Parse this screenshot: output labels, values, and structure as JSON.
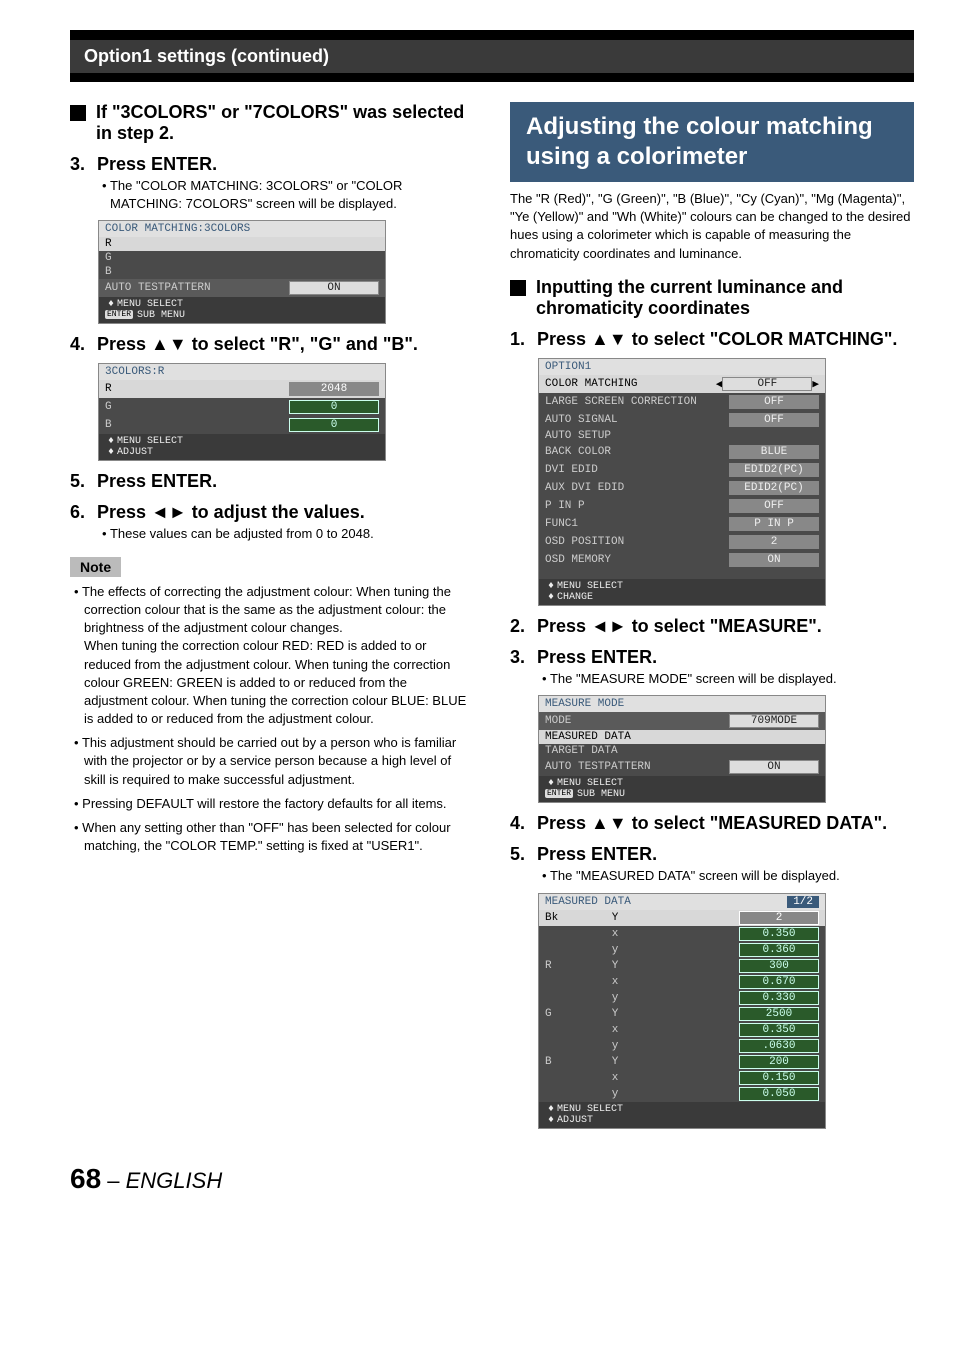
{
  "header": "Option1 settings (continued)",
  "left": {
    "sq_heading": "If \"3COLORS\" or \"7COLORS\" was selected in step 2.",
    "step3": "Press ENTER.",
    "step3_sub": "The \"COLOR MATCHING: 3COLORS\" or \"COLOR MATCHING: 7COLORS\" screen will be displayed.",
    "menu1": {
      "title": "COLOR MATCHING:3COLORS",
      "rows": [
        "R",
        "G",
        "B"
      ],
      "auto": "AUTO TESTPATTERN",
      "auto_val": "ON",
      "foot1": "MENU SELECT",
      "foot2": "SUB MENU",
      "enter": "ENTER"
    },
    "step4": "Press ▲▼ to select \"R\", \"G\" and \"B\".",
    "menu2": {
      "title": "3COLORS:R",
      "rows": [
        {
          "label": "R",
          "val": "2048"
        },
        {
          "label": "G",
          "val": "0"
        },
        {
          "label": "B",
          "val": "0"
        }
      ],
      "foot1": "MENU SELECT",
      "foot2": "ADJUST"
    },
    "step5": "Press ENTER.",
    "step6": "Press ◄► to adjust the values.",
    "step6_sub": "These values can be adjusted from 0 to 2048.",
    "note_label": "Note",
    "notes": [
      "The effects of correcting the adjustment colour: When tuning the correction colour that is the same as the adjustment colour: the brightness of the adjustment colour changes.\nWhen tuning the correction colour RED: RED is added to or reduced from the adjustment colour. When tuning the correction colour GREEN: GREEN is added to or reduced from the adjustment colour. When tuning the correction colour BLUE: BLUE is added to or reduced from the adjustment colour.",
      "This adjustment should be carried out by a person who is familiar with the projector or by a service person because a high level of skill is required to make successful adjustment.",
      "Pressing DEFAULT will restore the factory defaults for all items.",
      "When any setting other than \"OFF\" has been selected for colour matching, the \"COLOR TEMP.\" setting is fixed at \"USER1\"."
    ]
  },
  "right": {
    "big_title": "Adjusting the colour matching using a colorimeter",
    "intro": "The \"R (Red)\", \"G (Green)\", \"B (Blue)\", \"Cy (Cyan)\", \"Mg (Magenta)\", \"Ye (Yellow)\" and \"Wh (White)\" colours can be changed to the desired hues using a colorimeter which is capable of measuring the chromaticity coordinates and luminance.",
    "sq_heading": "Inputting the current luminance and chromaticity coordinates",
    "step1": "Press ▲▼ to select \"COLOR MATCHING\".",
    "menu3": {
      "title": "OPTION1",
      "rows": [
        {
          "label": "COLOR MATCHING",
          "val": "OFF",
          "sel": true,
          "arrows": true
        },
        {
          "label": "LARGE SCREEN CORRECTION",
          "val": "OFF"
        },
        {
          "label": "AUTO SIGNAL",
          "val": "OFF"
        },
        {
          "label": "AUTO SETUP",
          "val": ""
        },
        {
          "label": "BACK COLOR",
          "val": "BLUE"
        },
        {
          "label": "DVI EDID",
          "val": "EDID2(PC)"
        },
        {
          "label": "AUX DVI EDID",
          "val": "EDID2(PC)"
        },
        {
          "label": "P IN P",
          "val": "OFF"
        },
        {
          "label": "FUNC1",
          "val": "P IN P"
        },
        {
          "label": "OSD POSITION",
          "val": "2"
        },
        {
          "label": "OSD MEMORY",
          "val": "ON"
        }
      ],
      "foot1": "MENU SELECT",
      "foot2": "CHANGE"
    },
    "step2": "Press ◄► to select \"MEASURE\".",
    "step3": "Press ENTER.",
    "step3_sub": "The \"MEASURE MODE\" screen will be displayed.",
    "menu4": {
      "title": "MEASURE MODE",
      "rows": [
        {
          "label": "MODE",
          "val": "709MODE",
          "sel": true
        },
        {
          "label": "MEASURED DATA",
          "val": "",
          "white": true
        },
        {
          "label": "TARGET DATA",
          "val": ""
        },
        {
          "label": "AUTO TESTPATTERN",
          "val": "ON"
        }
      ],
      "foot1": "MENU SELECT",
      "foot2": "SUB MENU",
      "enter": "ENTER"
    },
    "step4": "Press ▲▼ to select \"MEASURED DATA\".",
    "step5": "Press ENTER.",
    "step5_sub": "The \"MEASURED DATA\" screen will be displayed.",
    "menu5": {
      "title": "MEASURED DATA",
      "page": "1/2",
      "rows": [
        {
          "c1": "Bk",
          "c2": "Y",
          "val": "2",
          "sel": true
        },
        {
          "c1": "",
          "c2": "x",
          "val": "0.350"
        },
        {
          "c1": "",
          "c2": "y",
          "val": "0.360"
        },
        {
          "c1": "R",
          "c2": "Y",
          "val": "300"
        },
        {
          "c1": "",
          "c2": "x",
          "val": "0.670"
        },
        {
          "c1": "",
          "c2": "y",
          "val": "0.330"
        },
        {
          "c1": "G",
          "c2": "Y",
          "val": "2500"
        },
        {
          "c1": "",
          "c2": "x",
          "val": "0.350"
        },
        {
          "c1": "",
          "c2": "y",
          "val": ".0630"
        },
        {
          "c1": "B",
          "c2": "Y",
          "val": "200"
        },
        {
          "c1": "",
          "c2": "x",
          "val": "0.150"
        },
        {
          "c1": "",
          "c2": "y",
          "val": "0.050"
        }
      ],
      "foot1": "MENU SELECT",
      "foot2": "ADJUST"
    }
  },
  "footer": {
    "page": "68",
    "dash": " – ",
    "lang": "ENGLISH"
  }
}
